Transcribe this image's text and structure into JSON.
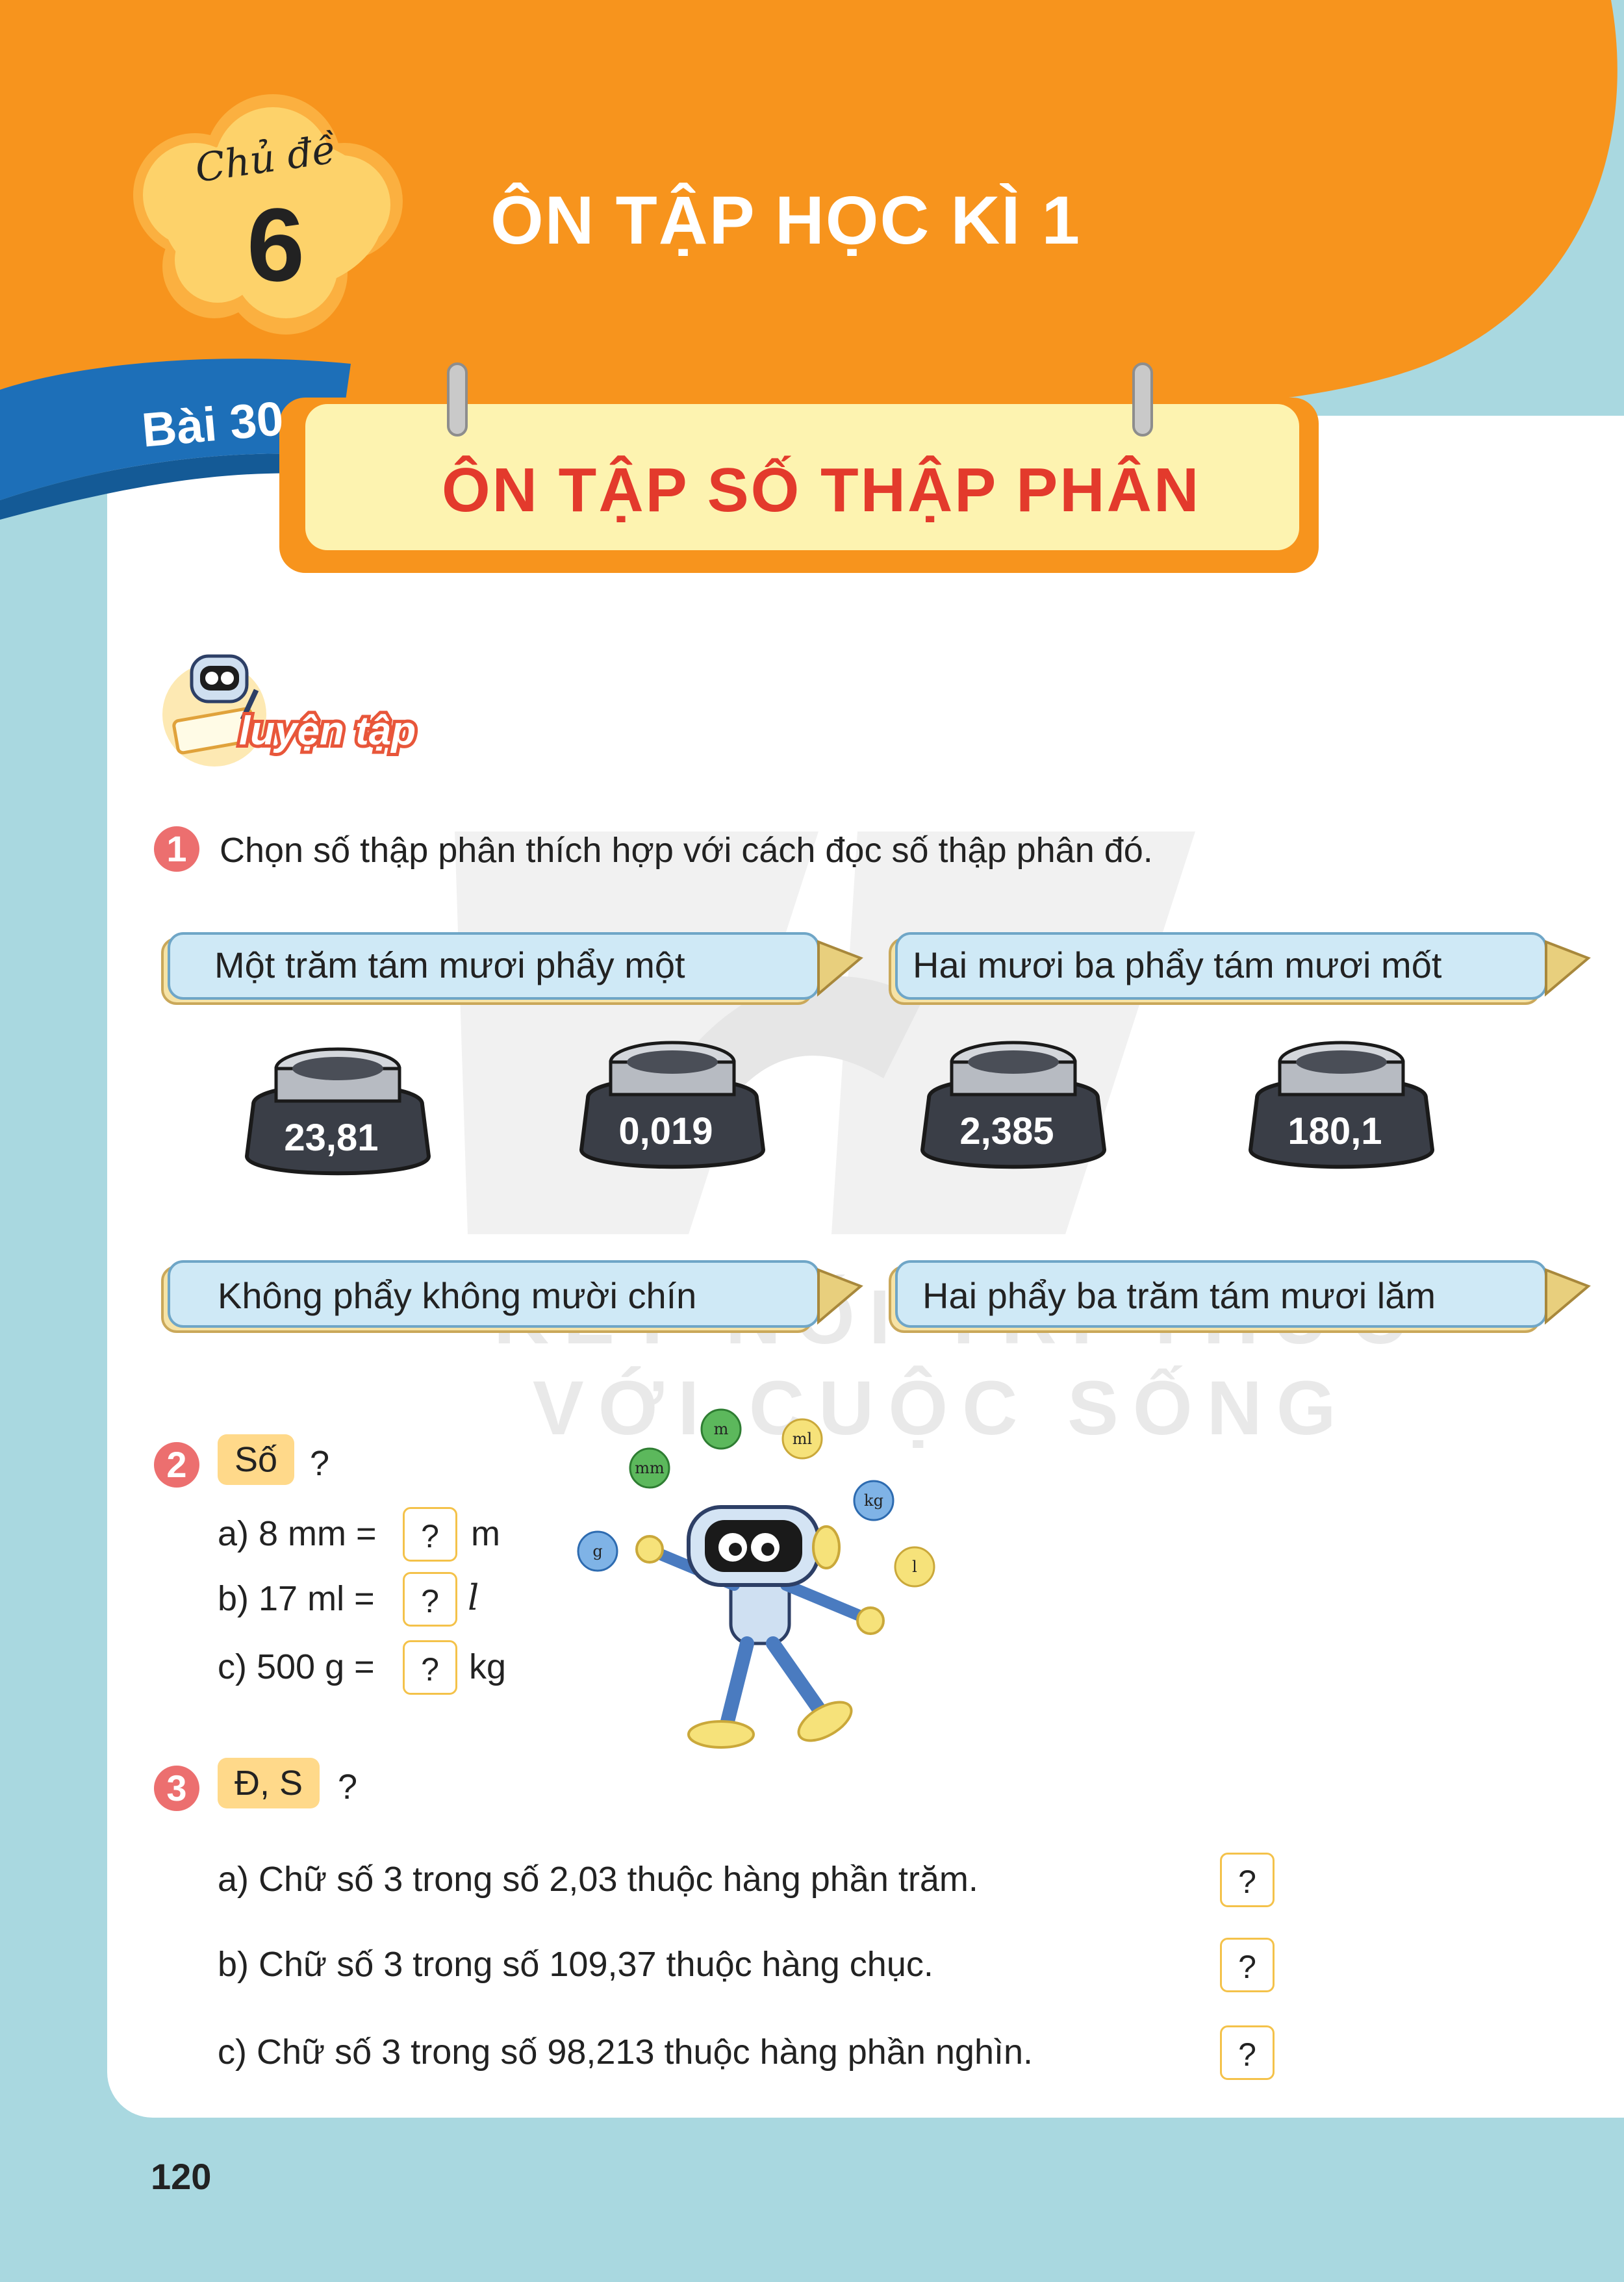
{
  "colors": {
    "orange": "#f7941d",
    "blue": "#1d6fb8",
    "cream": "#fdf3b0",
    "pink": "#ec6f6f",
    "light_blue": "#a9d8e0",
    "box_border": "#f4c24a"
  },
  "topic": {
    "chu_de_label": "Chủ đề",
    "number": "6",
    "title": "ÔN TẬP HỌC KÌ 1"
  },
  "lesson": {
    "number_label": "Bài 30",
    "title": "ÔN TẬP SỐ THẬP PHÂN"
  },
  "section": {
    "label": "luyện tập"
  },
  "watermark": {
    "line1": "KẾT NỐI TRI THỨC",
    "line2": "VỚI CUỘC SỐNG"
  },
  "q1": {
    "number": "1",
    "prompt": "Chọn số thập phân thích hợp với cách đọc số thập phân đó.",
    "pens_top": [
      "Một trăm tám mươi phẩy một",
      "Hai mươi ba phẩy tám mươi mốt"
    ],
    "inkwells": [
      "23,81",
      "0,019",
      "2,385",
      "180,1"
    ],
    "pens_bottom": [
      "Không phẩy không mười chín",
      "Hai phẩy ba trăm tám mươi lăm"
    ]
  },
  "q2": {
    "number": "2",
    "label": "Số",
    "mark": "?",
    "items": [
      {
        "prefix": "a) 8 mm =",
        "box": "?",
        "unit": "m"
      },
      {
        "prefix": "b) 17 ml =",
        "box": "?",
        "unit": "l"
      },
      {
        "prefix": "c) 500 g =",
        "box": "?",
        "unit": "kg"
      }
    ],
    "balls": [
      "m",
      "ml",
      "mm",
      "kg",
      "g",
      "l"
    ]
  },
  "q3": {
    "number": "3",
    "label": "Đ, S",
    "mark": "?",
    "items": [
      {
        "text": "a) Chữ số 3 trong số 2,03 thuộc hàng phần trăm.",
        "box": "?"
      },
      {
        "text": "b) Chữ số 3 trong số 109,37 thuộc hàng chục.",
        "box": "?"
      },
      {
        "text": "c) Chữ số 3 trong số 98,213 thuộc hàng phần nghìn.",
        "box": "?"
      }
    ]
  },
  "page_number": "120"
}
